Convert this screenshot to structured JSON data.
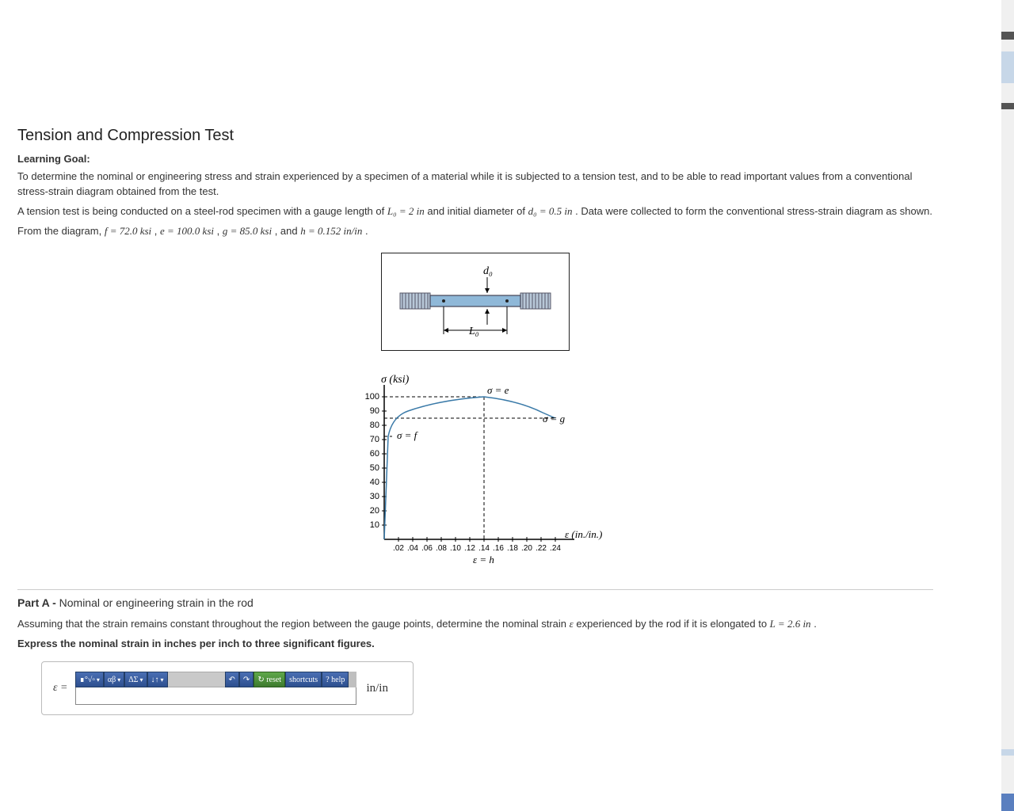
{
  "title": "Tension and Compression Test",
  "learning_label": "Learning Goal:",
  "goal_text": "To determine the nominal or engineering stress and strain experienced by a specimen of a material while it is subjected to a tension test, and to be able to read important values from a conventional stress-strain diagram obtained from the test.",
  "setup_pre": "A tension test is being conducted on a steel-rod specimen with a gauge length of ",
  "L0_expr": "L₀ = 2 in",
  "setup_mid": " and initial diameter of ",
  "d0_expr": "d₀ = 0.5 in",
  "setup_post": ". Data were collected to form the conventional stress-strain diagram as shown.",
  "values_line_pre": "From the diagram, ",
  "f_expr": "f = 72.0 ksi",
  "sep": " , ",
  "e_expr": "e = 100.0 ksi",
  "g_expr": "g = 85.0 ksi",
  "and": " , and ",
  "h_expr": "h = 0.152 in/in",
  "period": " .",
  "rod_labels": {
    "d0": "d₀",
    "L0": "L₀"
  },
  "chart_data": {
    "type": "line",
    "title": "",
    "xlabel": "ε (in./in.)",
    "ylabel": "σ (ksi)",
    "x_ticks": [
      ".02",
      ".04",
      ".06",
      ".08",
      ".10",
      ".12",
      ".14",
      ".16",
      ".18",
      ".20",
      ".22",
      ".24"
    ],
    "y_ticks": [
      10,
      20,
      30,
      40,
      50,
      60,
      70,
      80,
      90,
      100
    ],
    "xlim": [
      0,
      0.26
    ],
    "ylim": [
      0,
      105
    ],
    "series": [
      {
        "name": "stress-strain",
        "x": [
          0,
          0.005,
          0.01,
          0.03,
          0.08,
          0.14,
          0.2,
          0.24
        ],
        "y": [
          0,
          72,
          75,
          90,
          98,
          100,
          93,
          85
        ]
      }
    ],
    "annotations": {
      "sigma_f": {
        "label": "σ = f",
        "value": 72
      },
      "sigma_e": {
        "label": "σ = e",
        "value": 100,
        "at_x": 0.14
      },
      "sigma_g": {
        "label": "σ = g",
        "value": 85,
        "at_x": 0.24
      },
      "eps_h": {
        "label": "ε = h",
        "value": 0.152
      }
    }
  },
  "part_a": {
    "header_bold": "Part A - ",
    "header_rest": "Nominal or engineering strain in the rod",
    "question_pre": "Assuming that the strain remains constant throughout the region between the gauge points, determine the nominal strain ",
    "eps": "ε",
    "question_mid": " experienced by the rod if it is elongated to ",
    "L_expr": "L = 2.6 in",
    "question_end": " .",
    "instruction": "Express the nominal strain in inches per inch to three significant figures.",
    "answer_prefix": "ε =",
    "unit": "in/in"
  },
  "toolbar": {
    "b1": "∎°√▫",
    "b2": "αβ",
    "b3": "ΔΣ",
    "b4": "↓↑",
    "undo": "↶",
    "redo": "↷",
    "reset_icon": "↻",
    "reset": "reset",
    "shortcuts": "shortcuts",
    "help_icon": "?",
    "help": "help"
  }
}
